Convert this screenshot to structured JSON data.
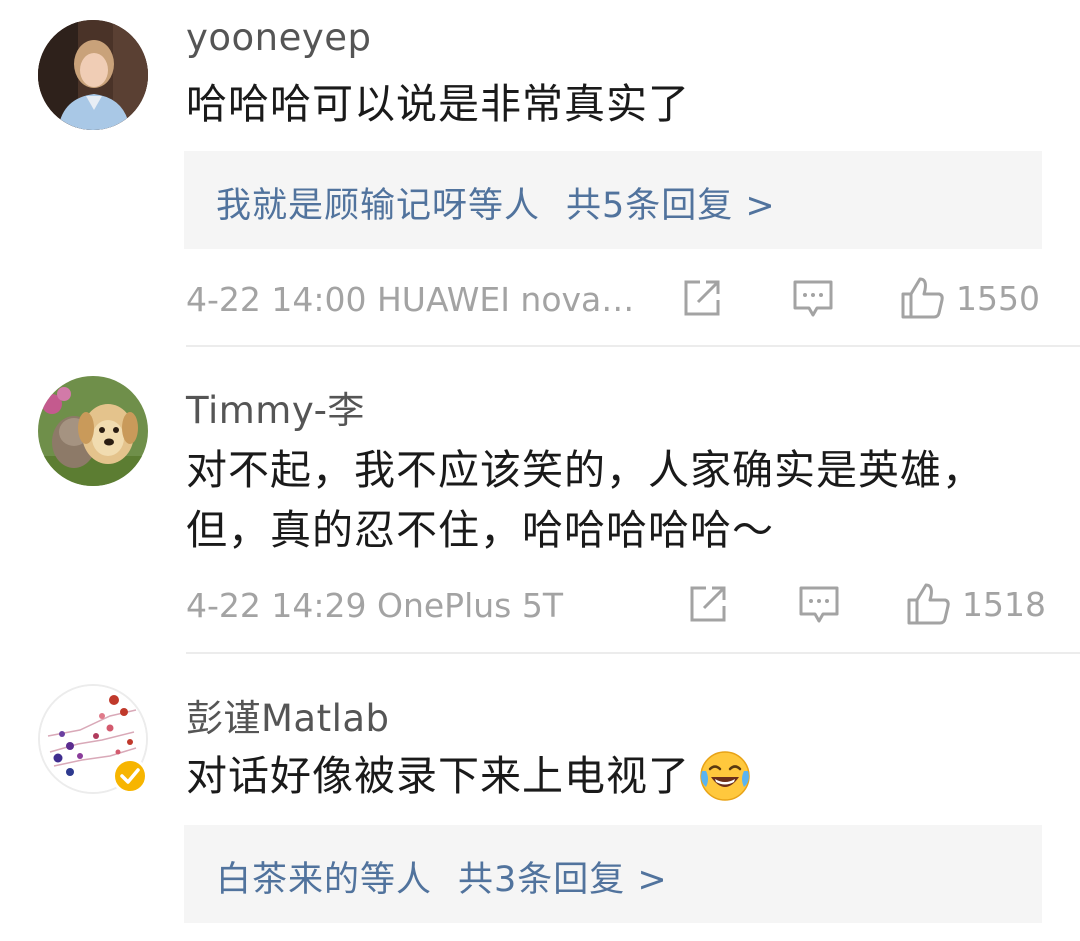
{
  "comments": [
    {
      "username": "yooneyep",
      "lines": [
        "哈哈哈可以说是非常真实了"
      ],
      "reply_prefix": "我就是顾输记呀等人",
      "reply_count": "共5条回复 >",
      "meta": "4-22 14:00 HUAWEI nova…",
      "likes": "1550"
    },
    {
      "username": "Timmy-李",
      "lines": [
        "对不起，我不应该笑的，人家确实是英雄，",
        "但，真的忍不住，哈哈哈哈哈～"
      ],
      "meta": "4-22 14:29 OnePlus 5T",
      "likes": "1518"
    },
    {
      "username": "彭谨Matlab",
      "lines": [
        "对话好像被录下来上电视了"
      ],
      "reply_prefix": "白茶来的等人",
      "reply_count": "共3条回复 >"
    }
  ],
  "icons": {
    "share": "share-icon",
    "comment": "comment-icon",
    "like": "thumbs-up-icon",
    "emoji": "laughing-crying-emoji-icon",
    "verified": "verified-badge-icon"
  },
  "colors": {
    "link": "#51739d",
    "meta": "#a3a3a3",
    "reply_bg": "#f5f5f5",
    "badge": "#f7b500"
  }
}
